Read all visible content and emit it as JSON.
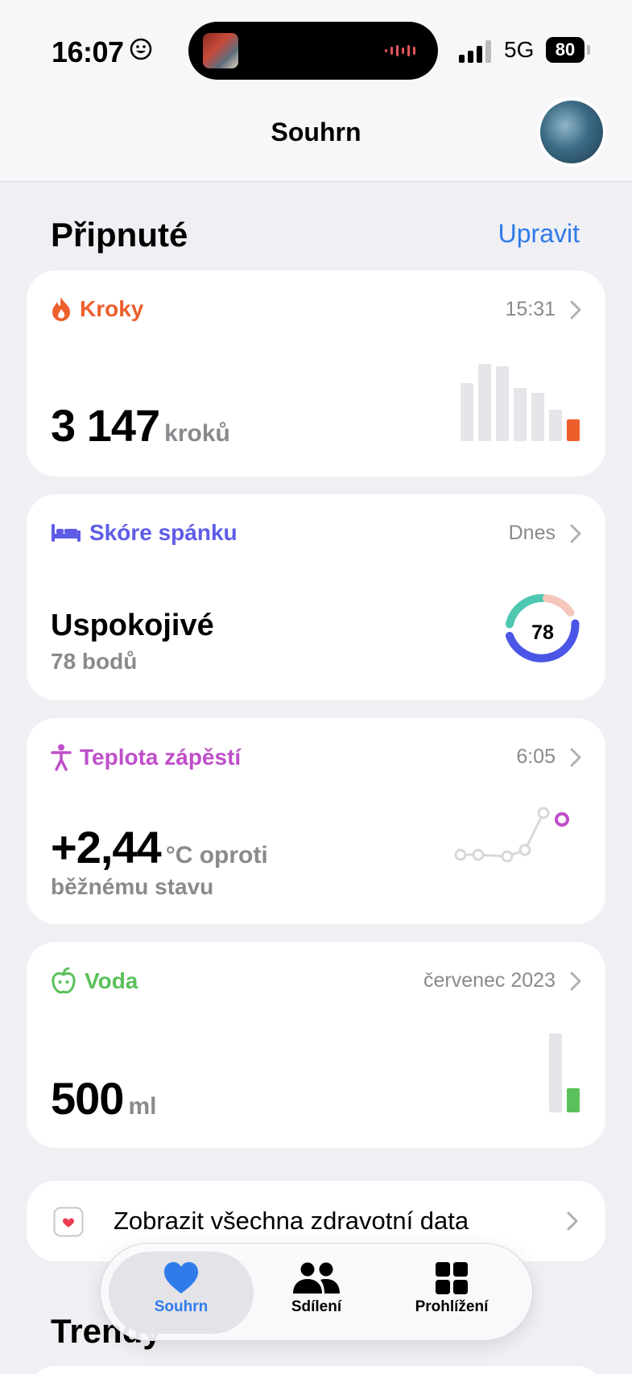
{
  "status_bar": {
    "time": "16:07",
    "network": "5G",
    "battery": "80"
  },
  "header": {
    "title": "Souhrn"
  },
  "pinned": {
    "title": "Připnuté",
    "edit_label": "Upravit"
  },
  "cards": {
    "steps": {
      "title": "Kroky",
      "time": "15:31",
      "value": "3 147",
      "unit": "kroků",
      "color": "#ec5f2c",
      "bars": [
        0.48,
        0.64,
        0.62,
        0.44,
        0.4,
        0.26,
        0.18
      ]
    },
    "sleep": {
      "title": "Skóre spánku",
      "time": "Dnes",
      "value": "Uspokojivé",
      "sub": "78 bodů",
      "score": "78",
      "color": "#5e5ce6"
    },
    "temp": {
      "title": "Teplota zápěstí",
      "time": "6:05",
      "value": "+2,44",
      "unit": "°C oproti",
      "sub": "běžnému stavu",
      "color": "#bf4fc9"
    },
    "water": {
      "title": "Voda",
      "time": "červenec 2023",
      "value": "500",
      "unit": "ml",
      "color": "#5ac15a"
    }
  },
  "all_data_link": "Zobrazit všechna zdravotní data",
  "trends_title": "Trendy",
  "tabs": [
    {
      "label": "Souhrn",
      "icon": "heart-icon",
      "active": true
    },
    {
      "label": "Sdílení",
      "icon": "people-icon",
      "active": false
    },
    {
      "label": "Prohlížení",
      "icon": "grid-icon",
      "active": false
    }
  ],
  "colors": {
    "accent": "#2f7bea"
  }
}
